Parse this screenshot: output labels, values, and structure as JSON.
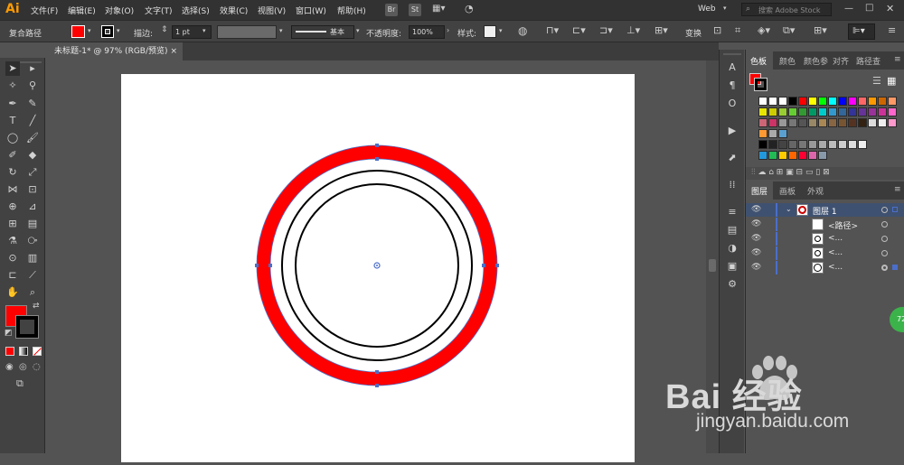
{
  "app": {
    "logo": "Ai"
  },
  "menu": [
    "文件(F)",
    "编辑(E)",
    "对象(O)",
    "文字(T)",
    "选择(S)",
    "效果(C)",
    "视图(V)",
    "窗口(W)",
    "帮助(H)"
  ],
  "top_right": {
    "badge_br": "Br",
    "badge_st": "St",
    "workspace": "Web",
    "search_placeholder": "搜索 Adobe Stock"
  },
  "control_bar": {
    "selection_label": "复合路径",
    "stroke_label": "描边:",
    "stroke_weight": "1 pt",
    "stroke_style": "基本",
    "opacity_label": "不透明度:",
    "opacity_value": "100%",
    "style_label": "样式:",
    "transform_label": "变换"
  },
  "document_tab": {
    "title": "未标题-1* @ 97% (RGB/预览)",
    "close": "×"
  },
  "colors": {
    "fill": "#ff0000",
    "stroke": "#000000",
    "accent": "#4b6ec9"
  },
  "color_panel": {
    "tabs": [
      "色板",
      "颜色",
      "颜色参",
      "对齐",
      "路径查"
    ]
  },
  "layers_panel": {
    "tabs": [
      "图层",
      "画板",
      "外观"
    ],
    "layer_name": "图层 1",
    "rows": [
      "<路径>",
      "<...",
      "<...",
      "<..."
    ]
  },
  "watermark": {
    "brand": "Bai  经验",
    "url": "jingyan.baidu.com"
  },
  "badge_green": "72"
}
